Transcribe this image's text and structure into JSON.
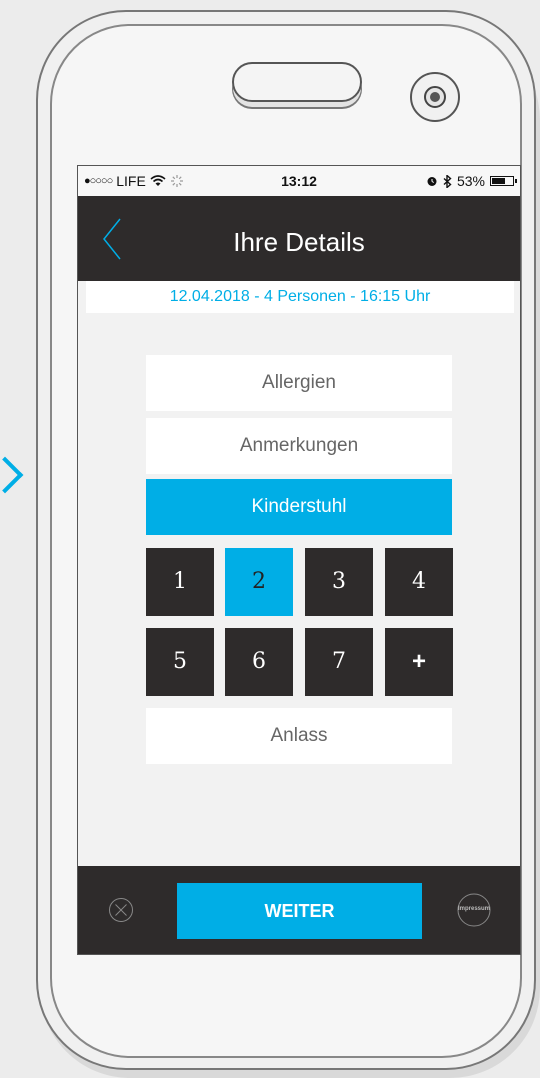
{
  "status_bar": {
    "signal": "●○○○○",
    "carrier": "LIFE",
    "wifi_icon": "wifi-icon",
    "loading_icon": "spinner-icon",
    "time": "13:12",
    "alarm_icon": "alarm-icon",
    "bluetooth_icon": "bluetooth-icon",
    "battery_percent": "53%",
    "battery_level": 0.53
  },
  "header": {
    "title": "Ihre Details",
    "back_icon": "chevron-left-icon"
  },
  "booking_summary": "12.04.2018 - 4 Personen - 16:15 Uhr",
  "options": {
    "allergies": "Allergien",
    "remarks": "Anmerkungen",
    "high_chair": "Kinderstuhl",
    "occasion": "Anlass"
  },
  "highchair_count": {
    "keys": [
      "1",
      "2",
      "3",
      "4",
      "5",
      "6",
      "7",
      "+"
    ],
    "selected": "2"
  },
  "footer": {
    "close_icon": "close-icon",
    "continue_label": "WEITER",
    "impressum_label": "Impressum"
  },
  "colors": {
    "accent": "#00aee6",
    "dark": "#2e2b2b",
    "background": "#f2f2f2"
  }
}
